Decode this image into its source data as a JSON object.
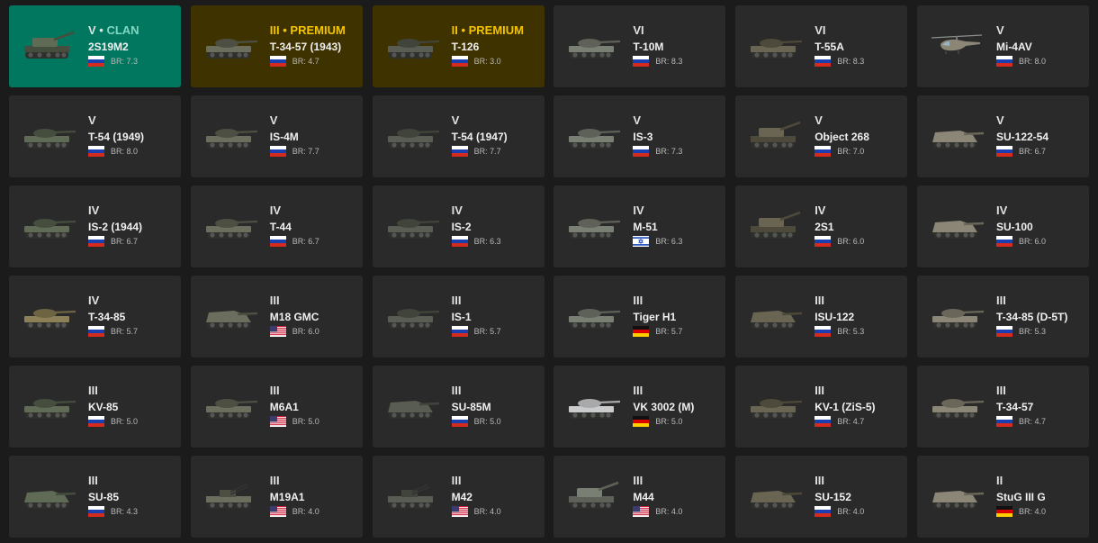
{
  "vehicles": [
    {
      "tier": "V",
      "tag": "CLAN",
      "variant": "clan",
      "name": "2S19M2",
      "nation": "ussr",
      "br": "BR: 7.3",
      "icon": "spg-icon"
    },
    {
      "tier": "III",
      "tag": "PREMIUM",
      "variant": "premium",
      "name": "T-34-57 (1943)",
      "nation": "ussr",
      "br": "BR: 4.7",
      "icon": "tank-icon"
    },
    {
      "tier": "II",
      "tag": "PREMIUM",
      "variant": "premium",
      "name": "T-126",
      "nation": "ussr",
      "br": "BR: 3.0",
      "icon": "tank-icon"
    },
    {
      "tier": "VI",
      "tag": "",
      "variant": "",
      "name": "T-10M",
      "nation": "ussr",
      "br": "BR: 8.3",
      "icon": "tank-icon"
    },
    {
      "tier": "VI",
      "tag": "",
      "variant": "",
      "name": "T-55A",
      "nation": "ussr",
      "br": "BR: 8.3",
      "icon": "tank-icon"
    },
    {
      "tier": "V",
      "tag": "",
      "variant": "",
      "name": "Mi-4AV",
      "nation": "ussr",
      "br": "BR: 8.0",
      "icon": "helicopter-icon"
    },
    {
      "tier": "V",
      "tag": "",
      "variant": "",
      "name": "T-54 (1949)",
      "nation": "ussr",
      "br": "BR: 8.0",
      "icon": "tank-icon"
    },
    {
      "tier": "V",
      "tag": "",
      "variant": "",
      "name": "IS-4M",
      "nation": "ussr",
      "br": "BR: 7.7",
      "icon": "tank-icon"
    },
    {
      "tier": "V",
      "tag": "",
      "variant": "",
      "name": "T-54 (1947)",
      "nation": "ussr",
      "br": "BR: 7.7",
      "icon": "tank-icon"
    },
    {
      "tier": "V",
      "tag": "",
      "variant": "",
      "name": "IS-3",
      "nation": "ussr",
      "br": "BR: 7.3",
      "icon": "tank-icon"
    },
    {
      "tier": "V",
      "tag": "",
      "variant": "",
      "name": "Object 268",
      "nation": "ussr",
      "br": "BR: 7.0",
      "icon": "spg-icon"
    },
    {
      "tier": "V",
      "tag": "",
      "variant": "",
      "name": "SU-122-54",
      "nation": "ussr",
      "br": "BR: 6.7",
      "icon": "tank-destroyer-icon"
    },
    {
      "tier": "IV",
      "tag": "",
      "variant": "",
      "name": "IS-2 (1944)",
      "nation": "ussr",
      "br": "BR: 6.7",
      "icon": "tank-icon"
    },
    {
      "tier": "IV",
      "tag": "",
      "variant": "",
      "name": "T-44",
      "nation": "ussr",
      "br": "BR: 6.7",
      "icon": "tank-icon"
    },
    {
      "tier": "IV",
      "tag": "",
      "variant": "",
      "name": "IS-2",
      "nation": "ussr",
      "br": "BR: 6.3",
      "icon": "tank-icon"
    },
    {
      "tier": "IV",
      "tag": "",
      "variant": "",
      "name": "M-51",
      "nation": "israel",
      "br": "BR: 6.3",
      "icon": "tank-icon"
    },
    {
      "tier": "IV",
      "tag": "",
      "variant": "",
      "name": "2S1",
      "nation": "ussr",
      "br": "BR: 6.0",
      "icon": "spg-icon"
    },
    {
      "tier": "IV",
      "tag": "",
      "variant": "",
      "name": "SU-100",
      "nation": "ussr",
      "br": "BR: 6.0",
      "icon": "tank-destroyer-icon"
    },
    {
      "tier": "IV",
      "tag": "",
      "variant": "",
      "name": "T-34-85",
      "nation": "ussr",
      "br": "BR: 5.7",
      "icon": "tank-icon"
    },
    {
      "tier": "III",
      "tag": "",
      "variant": "",
      "name": "M18 GMC",
      "nation": "usa",
      "br": "BR: 6.0",
      "icon": "tank-destroyer-icon"
    },
    {
      "tier": "III",
      "tag": "",
      "variant": "",
      "name": "IS-1",
      "nation": "ussr",
      "br": "BR: 5.7",
      "icon": "tank-icon"
    },
    {
      "tier": "III",
      "tag": "",
      "variant": "",
      "name": "Tiger H1",
      "nation": "germany",
      "br": "BR: 5.7",
      "icon": "tank-icon"
    },
    {
      "tier": "III",
      "tag": "",
      "variant": "",
      "name": "ISU-122",
      "nation": "ussr",
      "br": "BR: 5.3",
      "icon": "tank-destroyer-icon"
    },
    {
      "tier": "III",
      "tag": "",
      "variant": "",
      "name": "T-34-85 (D-5T)",
      "nation": "ussr",
      "br": "BR: 5.3",
      "icon": "tank-icon"
    },
    {
      "tier": "III",
      "tag": "",
      "variant": "",
      "name": "KV-85",
      "nation": "ussr",
      "br": "BR: 5.0",
      "icon": "tank-icon"
    },
    {
      "tier": "III",
      "tag": "",
      "variant": "",
      "name": "M6A1",
      "nation": "usa",
      "br": "BR: 5.0",
      "icon": "tank-icon"
    },
    {
      "tier": "III",
      "tag": "",
      "variant": "",
      "name": "SU-85M",
      "nation": "ussr",
      "br": "BR: 5.0",
      "icon": "tank-destroyer-icon"
    },
    {
      "tier": "III",
      "tag": "",
      "variant": "",
      "name": "VK 3002 (M)",
      "nation": "germany",
      "br": "BR: 5.0",
      "icon": "tank-icon"
    },
    {
      "tier": "III",
      "tag": "",
      "variant": "",
      "name": "KV-1 (ZiS-5)",
      "nation": "ussr",
      "br": "BR: 4.7",
      "icon": "tank-icon"
    },
    {
      "tier": "III",
      "tag": "",
      "variant": "",
      "name": "T-34-57",
      "nation": "ussr",
      "br": "BR: 4.7",
      "icon": "tank-icon"
    },
    {
      "tier": "III",
      "tag": "",
      "variant": "",
      "name": "SU-85",
      "nation": "ussr",
      "br": "BR: 4.3",
      "icon": "tank-destroyer-icon"
    },
    {
      "tier": "III",
      "tag": "",
      "variant": "",
      "name": "M19A1",
      "nation": "usa",
      "br": "BR: 4.0",
      "icon": "spaa-icon"
    },
    {
      "tier": "III",
      "tag": "",
      "variant": "",
      "name": "M42",
      "nation": "usa",
      "br": "BR: 4.0",
      "icon": "spaa-icon"
    },
    {
      "tier": "III",
      "tag": "",
      "variant": "",
      "name": "M44",
      "nation": "usa",
      "br": "BR: 4.0",
      "icon": "spg-icon"
    },
    {
      "tier": "III",
      "tag": "",
      "variant": "",
      "name": "SU-152",
      "nation": "ussr",
      "br": "BR: 4.0",
      "icon": "tank-destroyer-icon"
    },
    {
      "tier": "II",
      "tag": "",
      "variant": "",
      "name": "StuG III G",
      "nation": "germany",
      "br": "BR: 4.0",
      "icon": "tank-destroyer-icon"
    }
  ],
  "colors": {
    "page_bg": "#1b1b1b",
    "card_bg": "#2a2a2a",
    "clan_bg": "#00775e",
    "clan_accent": "#7fd8c2",
    "premium_bg": "#3d3200",
    "premium_accent": "#f5c400"
  }
}
